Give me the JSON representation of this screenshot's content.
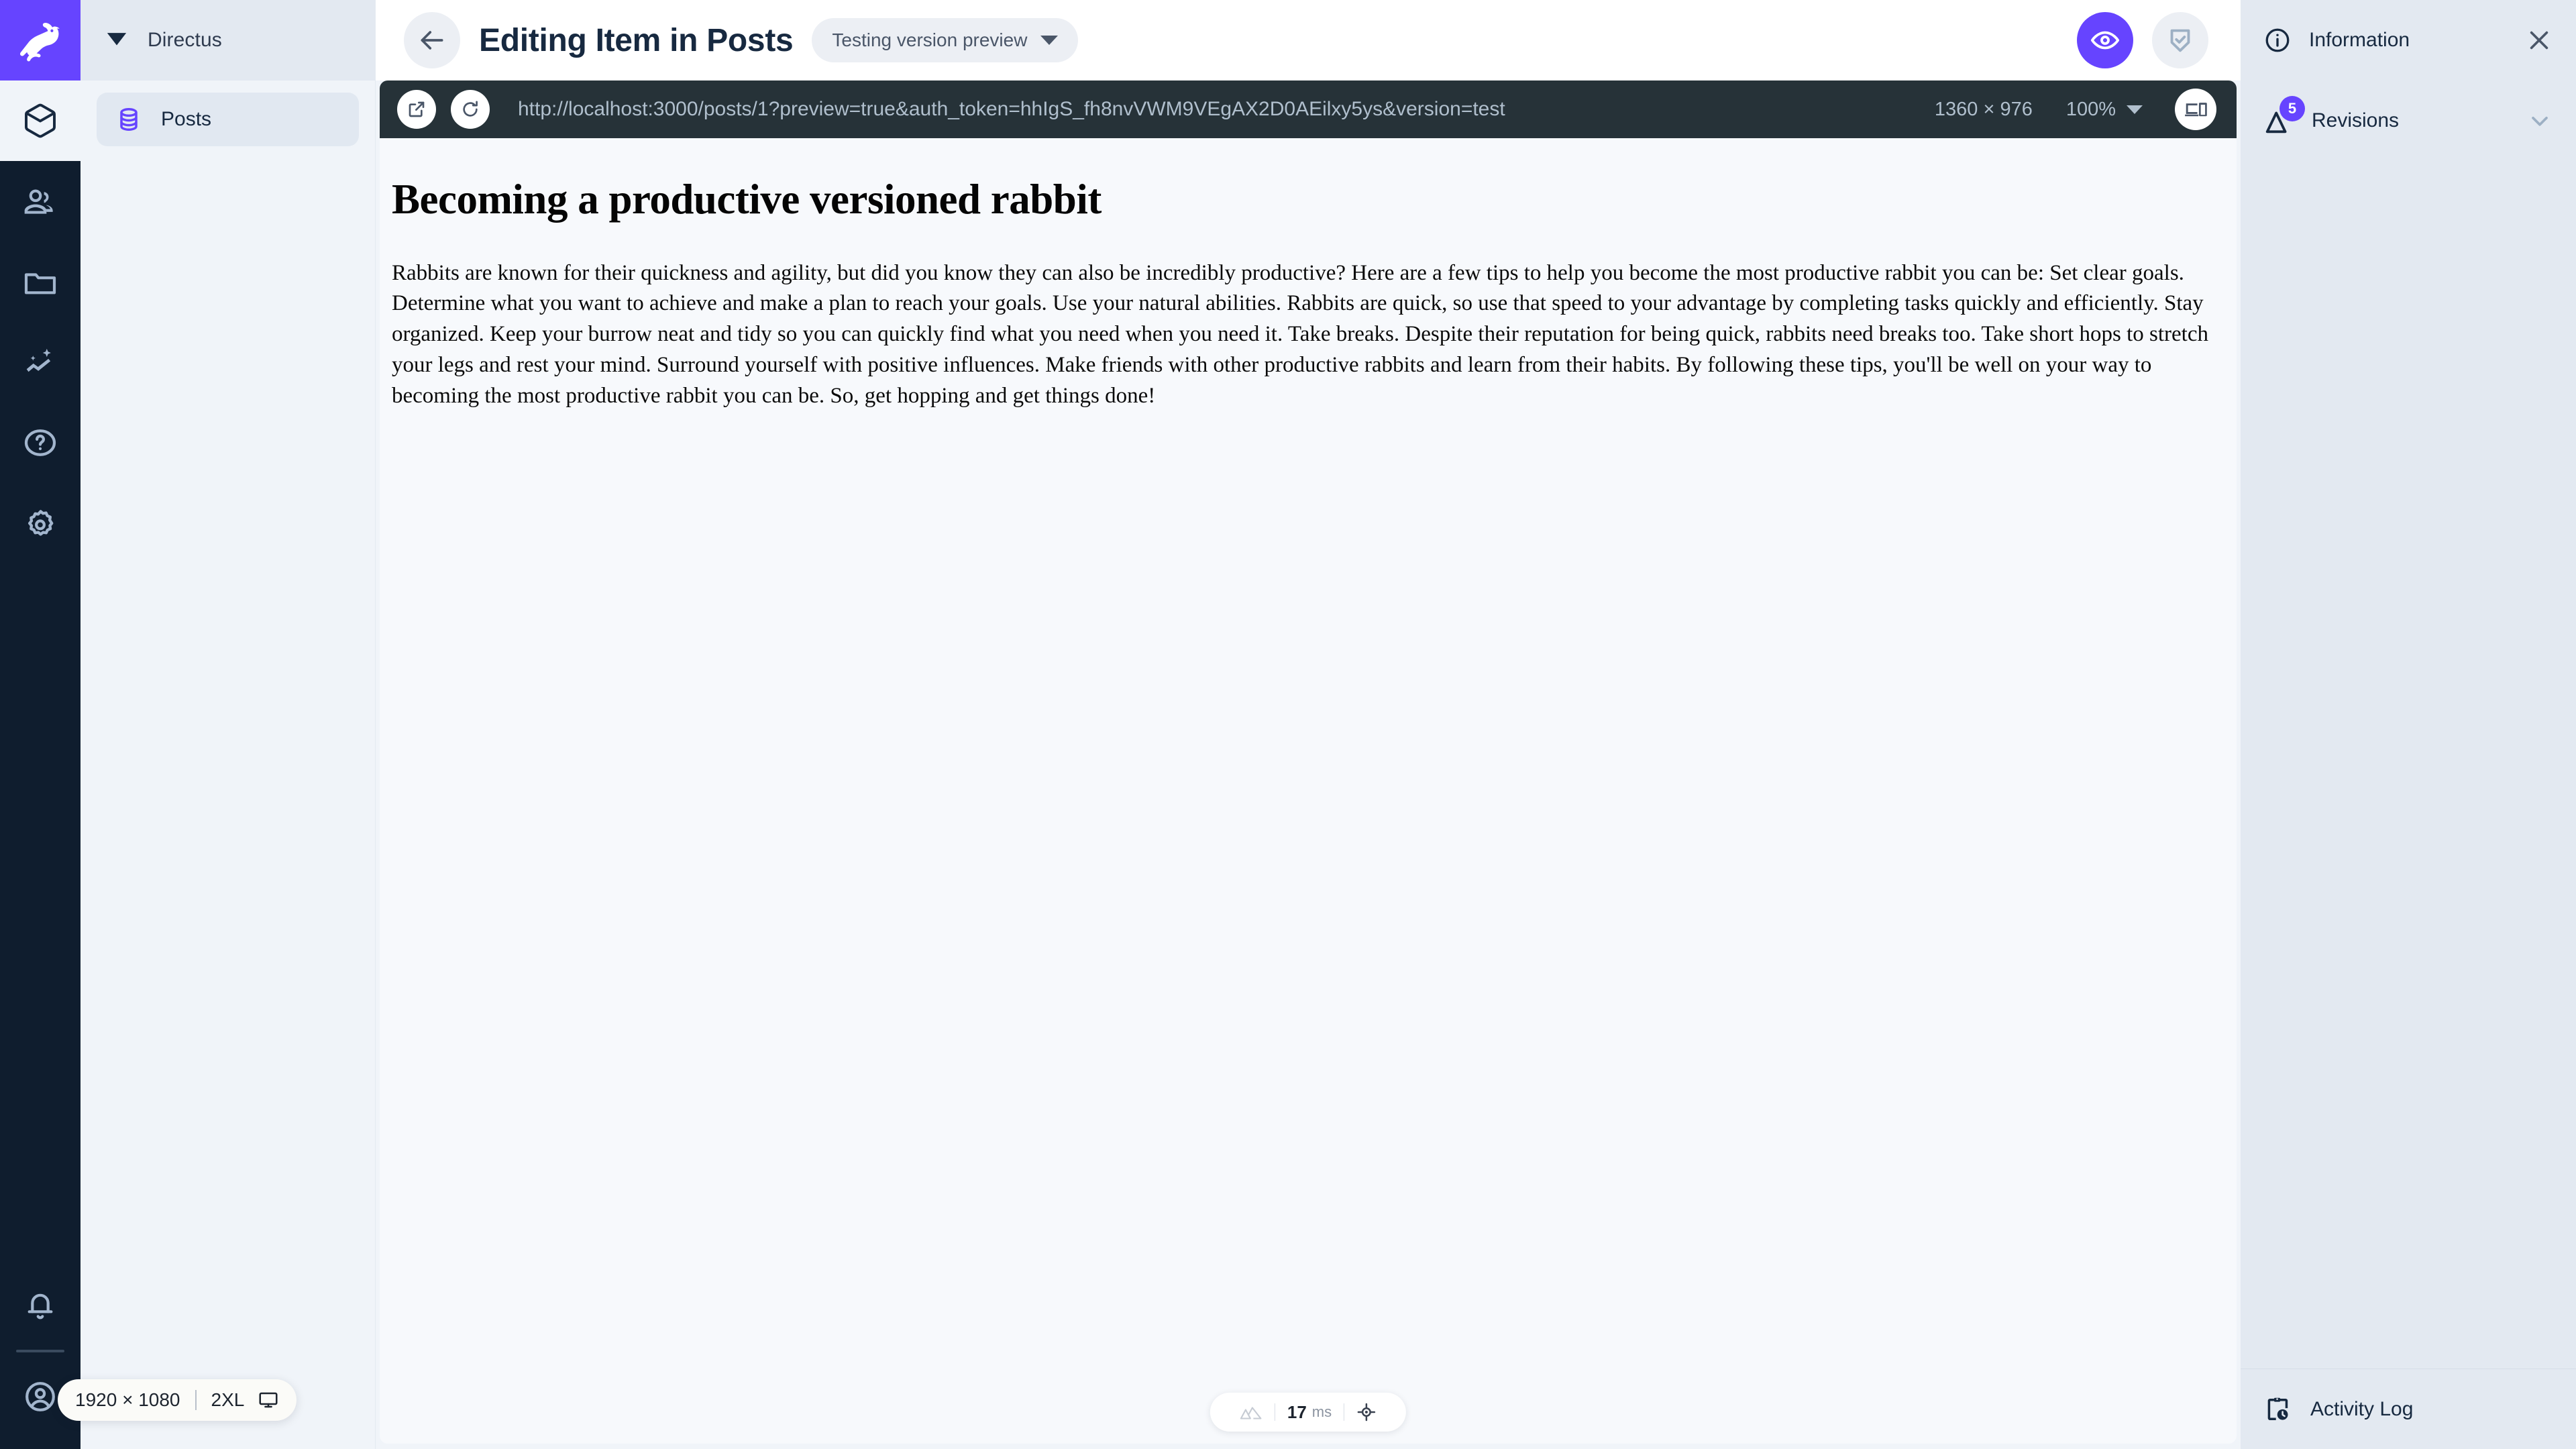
{
  "module_bar": {
    "logo_icon": "directus-rabbit-logo",
    "items": [
      {
        "icon": "box-icon",
        "name": "content",
        "active": true
      },
      {
        "icon": "users-icon",
        "name": "user-directory",
        "active": false
      },
      {
        "icon": "folder-icon",
        "name": "file-library",
        "active": false
      },
      {
        "icon": "insights-icon",
        "name": "insights",
        "active": false
      },
      {
        "icon": "help-icon",
        "name": "help",
        "active": false
      },
      {
        "icon": "gear-icon",
        "name": "settings",
        "active": false
      }
    ],
    "bottom_items": [
      {
        "icon": "bell-icon",
        "name": "notifications"
      },
      {
        "icon": "account-icon",
        "name": "user-account"
      }
    ]
  },
  "nav": {
    "header_title": "Directus",
    "header_icon": "bookmark-icon",
    "items": [
      {
        "label": "Posts",
        "icon": "database-icon",
        "active": true
      }
    ]
  },
  "topbar": {
    "back_icon": "arrow-left-icon",
    "title": "Editing Item in Posts",
    "version_chip": {
      "label": "Testing version preview",
      "icon": "chevron-down-icon"
    },
    "actions": [
      {
        "name": "preview-toggle-button",
        "icon": "eye-icon",
        "variant": "primary"
      },
      {
        "name": "save-button",
        "icon": "shield-check-icon",
        "variant": "ghost"
      }
    ]
  },
  "preview": {
    "open_new_tab_icon": "external-link-icon",
    "refresh_icon": "refresh-icon",
    "url": "http://localhost:3000/posts/1?preview=true&auth_token=hhIgS_fh8nvVWM9VEgAX2D0AEilxy5ys&version=test",
    "dimensions": "1360 × 976",
    "zoom": "100%",
    "device_icon": "device-toggle-icon",
    "document": {
      "heading": "Becoming a productive versioned rabbit",
      "body": "Rabbits are known for their quickness and agility, but did you know they can also be incredibly productive? Here are a few tips to help you become the most productive rabbit you can be: Set clear goals. Determine what you want to achieve and make a plan to reach your goals. Use your natural abilities. Rabbits are quick, so use that speed to your advantage by completing tasks quickly and efficiently. Stay organized. Keep your burrow neat and tidy so you can quickly find what you need when you need it. Take breaks. Despite their reputation for being quick, rabbits need breaks too. Take short hops to stretch your legs and rest your mind. Surround yourself with positive influences. Make friends with other productive rabbits and learn from their habits. By following these tips, you'll be well on your way to becoming the most productive rabbit you can be. So, get hopping and get things done!"
    },
    "devtools": {
      "nuxt_icon": "nuxt-icon",
      "timing_value": "17",
      "timing_unit": "ms",
      "inspect_icon": "target-icon"
    }
  },
  "viewport_badge": {
    "size": "1920 × 1080",
    "breakpoint": "2XL",
    "icon": "monitor-icon"
  },
  "drawer": {
    "header": {
      "icon": "info-icon",
      "title": "Information",
      "close_icon": "close-icon"
    },
    "sections": [
      {
        "icon": "revisions-icon",
        "label": "Revisions",
        "badge": "5",
        "chevron": "chevron-down-icon"
      }
    ],
    "footer": {
      "icon": "activity-log-icon",
      "label": "Activity Log"
    }
  },
  "colors": {
    "brand_purple": "#6644ff",
    "module_bar_bg": "#0f1d2e",
    "nav_bg": "#f0f4f9",
    "drawer_bg": "#e3e9f1",
    "url_bar_bg": "#263238",
    "page_bg": "#f7f9fc"
  }
}
